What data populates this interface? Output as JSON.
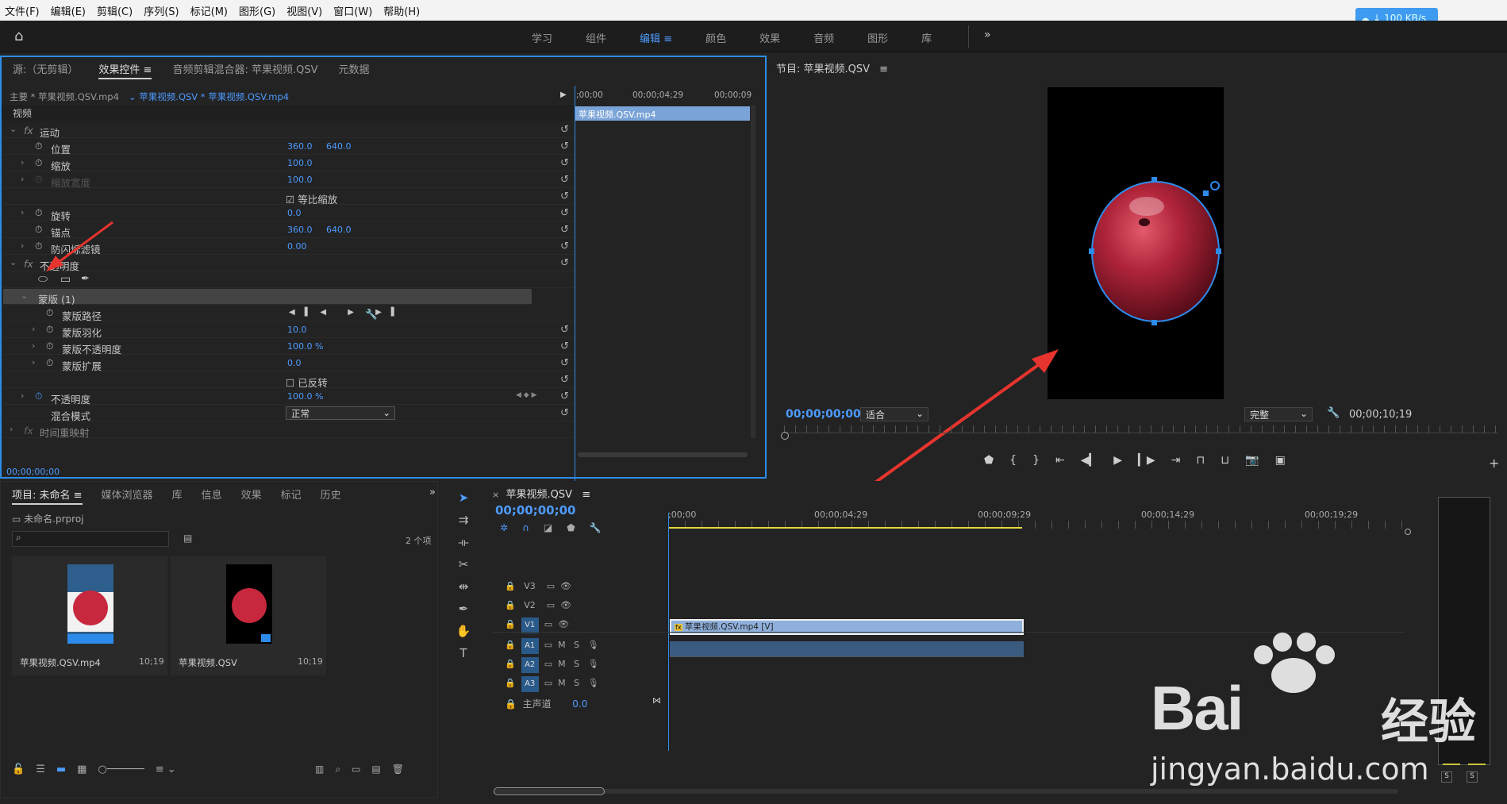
{
  "menu": [
    "文件(F)",
    "编辑(E)",
    "剪辑(C)",
    "序列(S)",
    "标记(M)",
    "图形(G)",
    "视图(V)",
    "窗口(W)",
    "帮助(H)"
  ],
  "net_badge": "100 KB/s",
  "workspaces": {
    "items": [
      "学习",
      "组件",
      "编辑",
      "颜色",
      "效果",
      "音频",
      "图形",
      "库"
    ],
    "active": "编辑"
  },
  "source_panel": {
    "tabs": [
      "源:（无剪辑）",
      "效果控件",
      "音频剪辑混合器: 苹果视频.QSV",
      "元数据"
    ],
    "active_tab": "效果控件",
    "master": "主要 * 苹果视频.QSV.mp4",
    "sequence_clip": "苹果视频.QSV * 苹果视频.QSV.mp4",
    "ruler": [
      ";00;00",
      "00;00;04;29",
      "00;00;09"
    ],
    "clip_bar": "苹果视频.QSV.mp4",
    "section_video": "视频",
    "motion": {
      "title": "运动",
      "position": {
        "label": "位置",
        "x": "360.0",
        "y": "640.0"
      },
      "scale": {
        "label": "缩放",
        "value": "100.0"
      },
      "scale_width": {
        "label": "缩放宽度",
        "value": "100.0"
      },
      "uniform_scale": "等比缩放",
      "rotation": {
        "label": "旋转",
        "value": "0.0"
      },
      "anchor": {
        "label": "锚点",
        "x": "360.0",
        "y": "640.0"
      },
      "antiflicker": {
        "label": "防闪烁滤镜",
        "value": "0.00"
      }
    },
    "opacity": {
      "title": "不透明度",
      "mask_title": "蒙版 (1)",
      "mask_path": "蒙版路径",
      "mask_feather": {
        "label": "蒙版羽化",
        "value": "10.0"
      },
      "mask_opacity": {
        "label": "蒙版不透明度",
        "value": "100.0 %"
      },
      "mask_expansion": {
        "label": "蒙版扩展",
        "value": "0.0"
      },
      "inverted": "已反转",
      "opacity": {
        "label": "不透明度",
        "value": "100.0 %"
      },
      "blend_mode": {
        "label": "混合模式",
        "value": "正常"
      }
    },
    "time_remap": "时间重映射",
    "timecode": "00;00;00;00"
  },
  "program_monitor": {
    "title": "节目: 苹果视频.QSV",
    "timecode": "00;00;00;00",
    "fit": "适合",
    "quality": "完整",
    "duration": "00;00;10;19"
  },
  "project_panel": {
    "tabs": [
      "项目: 未命名",
      "媒体浏览器",
      "库",
      "信息",
      "效果",
      "标记",
      "历史"
    ],
    "active_tab": "项目: 未命名",
    "project_file": "未命名.prproj",
    "item_count": "2 个项",
    "items": [
      {
        "name": "苹果视频.QSV.mp4",
        "duration": "10;19"
      },
      {
        "name": "苹果视频.QSV",
        "duration": "10;19"
      }
    ]
  },
  "timeline": {
    "title": "苹果视频.QSV",
    "timecode": "00;00;00;00",
    "ruler": [
      ";00;00",
      "00;00;04;29",
      "00;00;09;29",
      "00;00;14;29",
      "00;00;19;29"
    ],
    "video_tracks": [
      "V3",
      "V2",
      "V1"
    ],
    "audio_tracks": [
      "A1",
      "A2",
      "A3"
    ],
    "master": {
      "label": "主声道",
      "value": "0.0"
    },
    "clip": "苹果视频.QSV.mp4 [V]",
    "track_buttons": {
      "mute": "M",
      "solo": "S"
    }
  },
  "watermark": {
    "brand": "Bai",
    "cn": "经验",
    "url": "jingyan.baidu.com"
  },
  "meter_buttons": [
    "S",
    "S"
  ]
}
